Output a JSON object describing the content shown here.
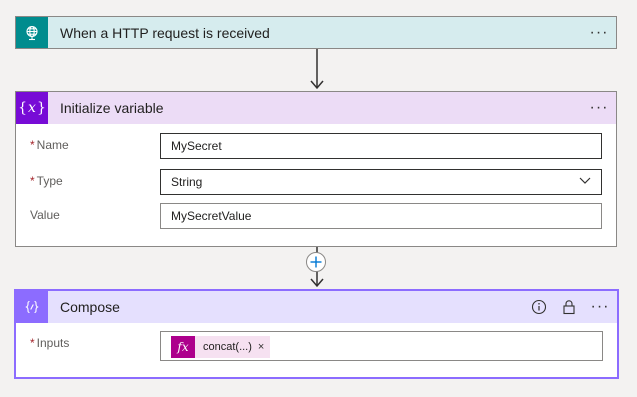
{
  "colors": {
    "trigger_accent": "#008c8e",
    "trigger_header_bg": "#d6ecee",
    "variable_accent": "#770bd6",
    "variable_header_bg": "#ecdcf6",
    "compose_accent": "#8c6cff",
    "compose_header_bg": "#e5e0fe",
    "function_token": "#ad008c",
    "required_marker": "#a4262c"
  },
  "trigger": {
    "title": "When a HTTP request is received",
    "icon": "globe-icon"
  },
  "init_variable": {
    "title": "Initialize variable",
    "icon": "curly-x-icon",
    "fields": {
      "name": {
        "label": "Name",
        "value": "MySecret",
        "required": "*"
      },
      "type": {
        "label": "Type",
        "value": "String",
        "required": "*"
      },
      "value": {
        "label": "Value",
        "value": "MySecretValue"
      }
    }
  },
  "compose": {
    "title": "Compose",
    "icon": "curly-braces-icon",
    "inputs": {
      "label": "Inputs",
      "required": "*",
      "token": {
        "fx": "fx",
        "text": "concat(...)",
        "remove": "×"
      }
    }
  }
}
